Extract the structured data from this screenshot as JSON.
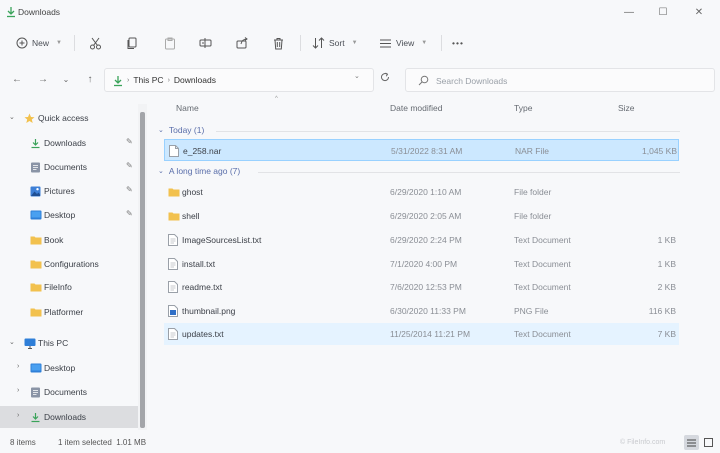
{
  "window": {
    "title": "Downloads",
    "minimize_glyph": "—",
    "maximize_glyph": "☐",
    "close_glyph": "✕"
  },
  "commands": {
    "new": "New",
    "sort": "Sort",
    "view": "View",
    "more": "•••",
    "icons": [
      "plus-circle-icon",
      "cut-icon",
      "copy-icon",
      "paste-icon",
      "rename-icon",
      "share-icon",
      "delete-icon",
      "sort-icon",
      "view-icon"
    ]
  },
  "nav": {
    "back": "←",
    "forward": "→",
    "recent": "⌄",
    "up": "↑"
  },
  "address": {
    "crumbs": [
      "This PC",
      "Downloads"
    ],
    "separator": "›"
  },
  "search": {
    "placeholder": "Search Downloads"
  },
  "sidebar": {
    "quick_access": "Quick access",
    "quick_items": [
      {
        "label": "Downloads",
        "icon": "download-icon",
        "pinned": true
      },
      {
        "label": "Documents",
        "icon": "documents-icon",
        "pinned": true
      },
      {
        "label": "Pictures",
        "icon": "pictures-icon",
        "pinned": true
      },
      {
        "label": "Desktop",
        "icon": "desktop-icon",
        "pinned": true
      },
      {
        "label": "Book",
        "icon": "folder-icon",
        "pinned": false
      },
      {
        "label": "Configurations",
        "icon": "folder-icon",
        "pinned": false
      },
      {
        "label": "FileInfo",
        "icon": "folder-icon",
        "pinned": false
      },
      {
        "label": "Platformer",
        "icon": "folder-icon",
        "pinned": false
      }
    ],
    "this_pc": "This PC",
    "pc_items": [
      {
        "label": "Desktop",
        "icon": "desktop-icon"
      },
      {
        "label": "Documents",
        "icon": "documents-icon"
      },
      {
        "label": "Downloads",
        "icon": "download-icon",
        "selected": true
      }
    ]
  },
  "columns": {
    "name": "Name",
    "date": "Date modified",
    "type": "Type",
    "size": "Size"
  },
  "groups": [
    {
      "label": "Today (1)",
      "rows": [
        {
          "name": "e_258.nar",
          "date": "5/31/2022 8:31 AM",
          "type": "NAR File",
          "size": "1,045 KB",
          "icon": "file-icon",
          "state": "selected"
        }
      ]
    },
    {
      "label": "A long time ago (7)",
      "rows": [
        {
          "name": "ghost",
          "date": "6/29/2020 1:10 AM",
          "type": "File folder",
          "size": "",
          "icon": "folder-icon"
        },
        {
          "name": "shell",
          "date": "6/29/2020 2:05 AM",
          "type": "File folder",
          "size": "",
          "icon": "folder-icon"
        },
        {
          "name": "ImageSourcesList.txt",
          "date": "6/29/2020 2:24 PM",
          "type": "Text Document",
          "size": "1 KB",
          "icon": "text-file-icon"
        },
        {
          "name": "install.txt",
          "date": "7/1/2020 4:00 PM",
          "type": "Text Document",
          "size": "1 KB",
          "icon": "text-file-icon"
        },
        {
          "name": "readme.txt",
          "date": "7/6/2020 12:53 PM",
          "type": "Text Document",
          "size": "2 KB",
          "icon": "text-file-icon"
        },
        {
          "name": "thumbnail.png",
          "date": "6/30/2020 11:33 PM",
          "type": "PNG File",
          "size": "116 KB",
          "icon": "image-file-icon"
        },
        {
          "name": "updates.txt",
          "date": "11/25/2014 11:21 PM",
          "type": "Text Document",
          "size": "7 KB",
          "icon": "text-file-icon",
          "state": "hover"
        }
      ]
    }
  ],
  "status": {
    "items": "8 items",
    "selected": "1 item selected  1.01 MB",
    "watermark": "© FileInfo.com"
  },
  "colors": {
    "accent": "#0067c0",
    "folder": "#f2c14e",
    "selection": "#cce8ff",
    "group_header": "#5a6eaa"
  }
}
